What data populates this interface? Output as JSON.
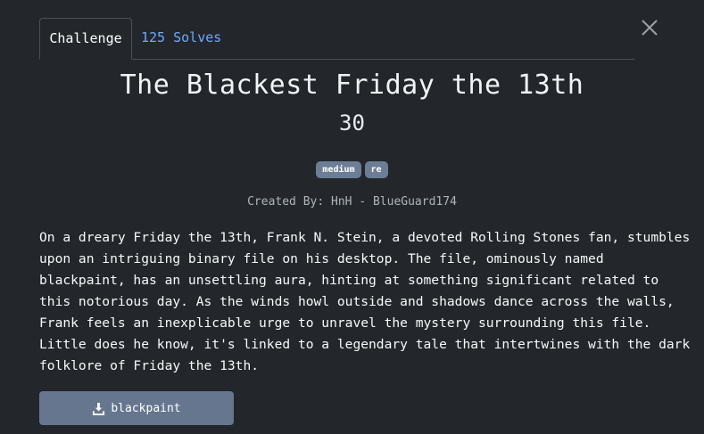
{
  "tabs": [
    {
      "label": "Challenge"
    },
    {
      "label": "125 Solves"
    }
  ],
  "challenge": {
    "title": "The Blackest Friday the 13th",
    "points": "30",
    "tags": [
      "medium",
      "re"
    ],
    "author": "Created By: HnH - BlueGuard174",
    "description_lines": [
      "On a dreary Friday the 13th, Frank N. Stein, a devoted Rolling Stones fan, stumbles",
      "upon an intriguing binary file on his desktop. The file, ominously named",
      "blackpaint, has an unsettling aura, hinting at something significant related to",
      "this notorious day. As the winds howl outside and shadows dance across the walls,",
      "Frank feels an inexplicable urge to unravel the mystery surrounding this file.",
      "Little does he know, it's linked to a legendary tale that intertwines with the dark",
      "folklore of Friday the 13th."
    ]
  },
  "file": {
    "name": "blackpaint",
    "icon": "download-icon"
  },
  "close_icon": "close-icon",
  "colors": {
    "background": "#23272b",
    "link": "#6ea8fe",
    "tag": "#6c7d96",
    "button": "#66768f"
  }
}
